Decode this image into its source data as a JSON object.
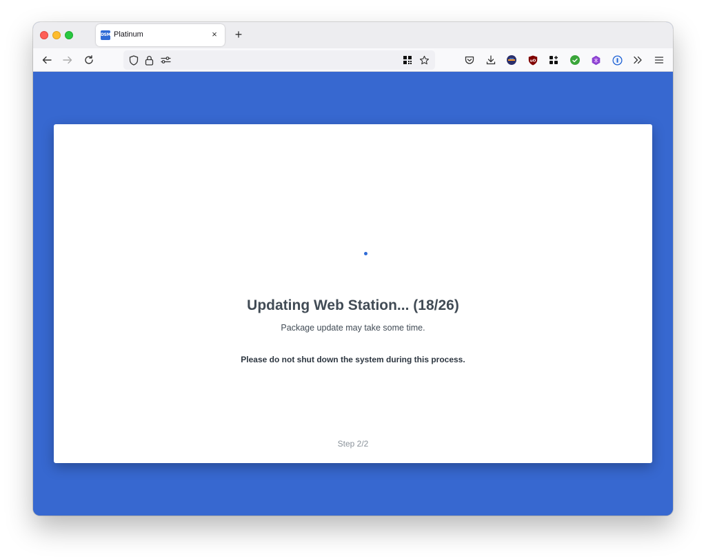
{
  "browser": {
    "tab": {
      "title": "Platinum",
      "favicon_text": "DSM",
      "close_glyph": "×"
    },
    "new_tab_glyph": "+"
  },
  "toolbar": {
    "extensions": [
      {
        "name": "pocket-icon"
      },
      {
        "name": "download-icon"
      },
      {
        "name": "extension-globe-icon",
        "color": "#2b2f6b"
      },
      {
        "name": "ublock-origin-icon",
        "color": "#800000",
        "text": "uD"
      },
      {
        "name": "grid-plus-icon"
      },
      {
        "name": "checkmark-extension-icon",
        "color": "#3aa53a"
      },
      {
        "name": "purple-extension-icon",
        "color": "#8a3fd1"
      },
      {
        "name": "1password-icon",
        "color": "#1a5fd4"
      },
      {
        "name": "overflow-menu-icon"
      },
      {
        "name": "hamburger-menu-icon"
      }
    ]
  },
  "page": {
    "background": "#3768d0",
    "heading": "Updating Web Station... (18/26)",
    "subtext": "Package update may take some time.",
    "warning": "Please do not shut down the system during this process.",
    "step": "Step 2/2"
  }
}
